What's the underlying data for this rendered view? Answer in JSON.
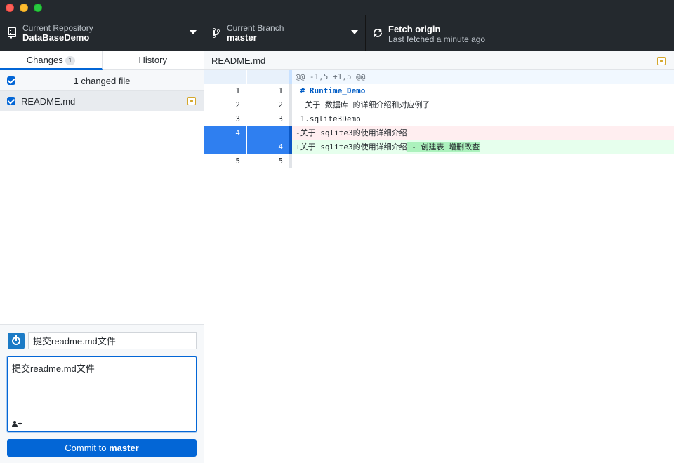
{
  "toolbar": {
    "repo_label": "Current Repository",
    "repo_value": "DataBaseDemo",
    "branch_label": "Current Branch",
    "branch_value": "master",
    "fetch_title": "Fetch origin",
    "fetch_subtitle": "Last fetched a minute ago"
  },
  "sidebar": {
    "tabs": [
      {
        "label": "Changes",
        "count": "1"
      },
      {
        "label": "History"
      }
    ],
    "changes_header": "1 changed file",
    "files": [
      {
        "name": "README.md",
        "status": "modified"
      }
    ]
  },
  "commit": {
    "summary_value": "提交readme.md文件",
    "description_value": "提交readme.md文件",
    "button_prefix": "Commit to ",
    "button_branch": "master"
  },
  "diff": {
    "file_name": "README.md",
    "hunk_header": "@@ -1,5 +1,5 @@",
    "lines": [
      {
        "type": "ctx",
        "old": "1",
        "new": "1",
        "prefix": " ",
        "text": "# Runtime_Demo"
      },
      {
        "type": "ctx",
        "old": "2",
        "new": "2",
        "prefix": " ",
        "text": " 关于 数据库 的详细介绍和对应例子"
      },
      {
        "type": "ctx",
        "old": "3",
        "new": "3",
        "prefix": " ",
        "text": "1.sqlite3Demo"
      },
      {
        "type": "del",
        "old": "4",
        "new": "",
        "prefix": "-",
        "text": "关于 sqlite3的使用详细介绍"
      },
      {
        "type": "add",
        "old": "",
        "new": "4",
        "prefix": "+",
        "text": "关于 sqlite3的使用详细介绍",
        "highlight": " - 创建表 增删改查"
      },
      {
        "type": "ctx",
        "old": "5",
        "new": "5",
        "prefix": " ",
        "text": ""
      }
    ]
  },
  "colors": {
    "accent": "#0366d6",
    "toolbar_bg": "#24292e",
    "modified": "#d4a72c"
  }
}
